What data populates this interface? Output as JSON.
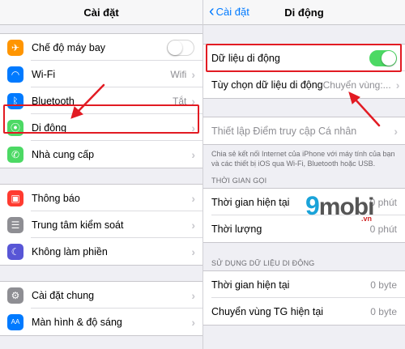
{
  "left": {
    "title": "Cài đặt",
    "groups": [
      [
        {
          "icon": "airplane-icon",
          "icon_glyph": "✈",
          "color": "#ff9500",
          "label": "Chế độ máy bay",
          "value": "",
          "toggle": false
        },
        {
          "icon": "wifi-icon",
          "icon_glyph": "◠",
          "color": "#007aff",
          "label": "Wi-Fi",
          "value": "Wifi"
        },
        {
          "icon": "bluetooth-icon",
          "icon_glyph": "ᛒ",
          "color": "#007aff",
          "label": "Bluetooth",
          "value": "Tắt"
        },
        {
          "icon": "cellular-icon",
          "icon_glyph": "⦿",
          "color": "#4cd964",
          "label": "Di động",
          "value": ""
        },
        {
          "icon": "phone-icon",
          "icon_glyph": "✆",
          "color": "#4cd964",
          "label": "Nhà cung cấp",
          "value": ""
        }
      ],
      [
        {
          "icon": "notifications-icon",
          "icon_glyph": "▣",
          "color": "#ff3b30",
          "label": "Thông báo",
          "value": ""
        },
        {
          "icon": "control-center-icon",
          "icon_glyph": "☰",
          "color": "#8e8e93",
          "label": "Trung tâm kiểm soát",
          "value": ""
        },
        {
          "icon": "do-not-disturb-icon",
          "icon_glyph": "☾",
          "color": "#5856d6",
          "label": "Không làm phiền",
          "value": ""
        }
      ],
      [
        {
          "icon": "general-gear-icon",
          "icon_glyph": "⚙",
          "color": "#8e8e93",
          "label": "Cài đặt chung",
          "value": ""
        },
        {
          "icon": "display-brightness-icon",
          "icon_glyph": "AA",
          "color": "#007aff",
          "label": "Màn hình & độ sáng",
          "value": ""
        }
      ]
    ]
  },
  "right": {
    "back_label": "Cài đặt",
    "title": "Di động",
    "cellular_data": {
      "label": "Dữ liệu di động",
      "toggle": true
    },
    "cellular_options": {
      "label": "Tùy chọn dữ liệu di động",
      "value": "Chuyển vùng:..."
    },
    "hotspot": {
      "label": "Thiết lập Điểm truy cập Cá nhân"
    },
    "footnote": "Chia sẻ kết nối Internet của iPhone với máy tính của bạn và các thiết bị iOS qua Wi-Fi, Bluetooth hoặc USB.",
    "call_time_header": "THỜI GIAN GỌI",
    "call_time": [
      {
        "label": "Thời gian hiện tại",
        "value": "0 phút"
      },
      {
        "label": "Thời lượng",
        "value": "0 phút"
      }
    ],
    "usage_header": "SỬ DỤNG DỮ LIỆU DI ĐỘNG",
    "usage": [
      {
        "label": "Thời gian hiện tại",
        "value": "0 byte"
      },
      {
        "label": "Chuyển vùng TG hiện tại",
        "value": "0 byte"
      }
    ]
  },
  "watermark": {
    "brand": "mobi",
    "digit": "9",
    "domain": ".vn"
  },
  "annotation_color": "#e21b23"
}
